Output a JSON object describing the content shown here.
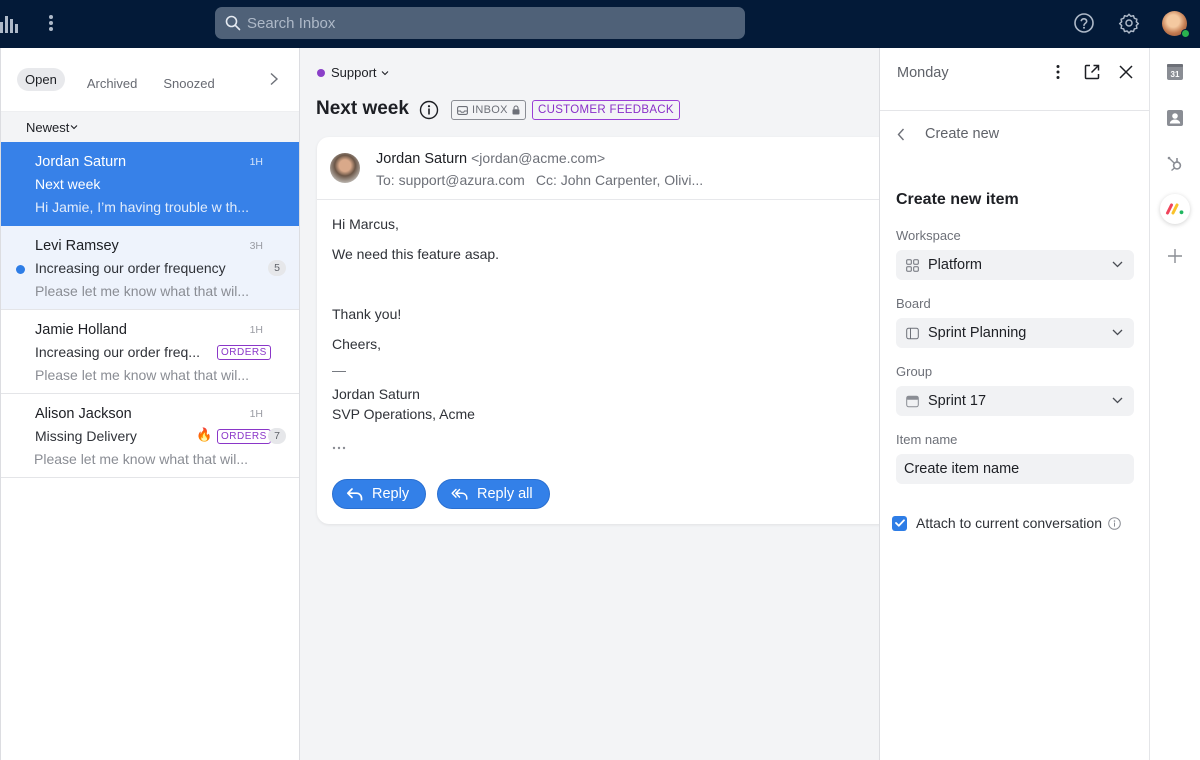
{
  "topbar": {
    "search_placeholder": "Search Inbox"
  },
  "list": {
    "tabs": [
      {
        "label": "Open",
        "active": true
      },
      {
        "label": "Archived",
        "active": false
      },
      {
        "label": "Snoozed",
        "active": false
      }
    ],
    "sort_label": "Newest",
    "conversations": [
      {
        "name": "Jordan Saturn",
        "time": "1H",
        "subject": "Next week",
        "preview": "Hi Jamie, I’m having trouble w th...",
        "selected": true
      },
      {
        "name": "Levi Ramsey",
        "time": "3H",
        "subject": "Increasing our order frequency",
        "preview": "Please let me know what that wil...",
        "unread": true,
        "count": "5"
      },
      {
        "name": "Jamie Holland",
        "time": "1H",
        "subject": "Increasing our order freq...",
        "preview": "Please let me know what that wil...",
        "tag": "ORDERS"
      },
      {
        "name": "Alison Jackson",
        "time": "1H",
        "subject": "Missing Delivery",
        "preview": "Please let me know what that wil...",
        "tag": "ORDERS",
        "emoji": "🔥",
        "count": "7"
      }
    ]
  },
  "thread": {
    "inbox_name": "Support",
    "inbox_color": "#8a3fc8",
    "title": "Next week",
    "inbox_tag": "INBOX",
    "label_tag": "CUSTOMER FEEDBACK",
    "message": {
      "sender_name": "Jordan Saturn",
      "sender_email": "<jordan@acme.com>",
      "to": "To: support@azura.com",
      "cc": "Cc: John Carpenter, Olivi...",
      "body": {
        "greeting": "Hi Marcus,",
        "line1": "We need this feature asap.",
        "thanks": "Thank you!",
        "closing": "Cheers,",
        "sig_dash": "—",
        "sig_name": "Jordan Saturn",
        "sig_title": "SVP Operations, Acme"
      }
    },
    "reply_label": "Reply",
    "reply_all_label": "Reply all"
  },
  "panel": {
    "title": "Monday",
    "back_label": "Create new",
    "form_title": "Create new item",
    "workspace_label": "Workspace",
    "workspace_value": "Platform",
    "board_label": "Board",
    "board_value": "Sprint Planning",
    "group_label": "Group",
    "group_value": "Sprint 17",
    "item_name_label": "Item name",
    "item_name_placeholder": "Create item name",
    "attach_label": "Attach to current conversation",
    "attach_checked": true
  },
  "rail": {
    "calendar_day": "31"
  },
  "colors": {
    "accent": "#3380e8",
    "topbar": "#031a38",
    "tag_purple": "#8a36c8"
  }
}
